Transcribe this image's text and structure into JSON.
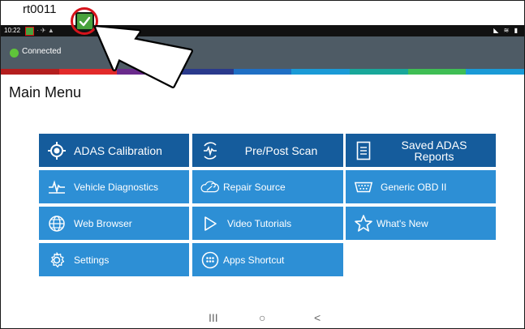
{
  "device": {
    "id": "rt0011"
  },
  "status_bar": {
    "time": "10:22"
  },
  "connection": {
    "status": "Connected",
    "color": "#5fc43a"
  },
  "page": {
    "title": "Main Menu"
  },
  "menu": {
    "adas_calibration": "ADAS Calibration",
    "pre_post_scan": "Pre/Post Scan",
    "saved_adas_reports": "Saved ADAS Reports",
    "vehicle_diagnostics": "Vehicle Diagnostics",
    "repair_source": "Repair Source",
    "generic_obd": "Generic OBD II",
    "web_browser": "Web Browser",
    "video_tutorials": "Video Tutorials",
    "whats_new": "What's New",
    "settings": "Settings",
    "apps_shortcut": "Apps Shortcut"
  },
  "nav": {
    "recents": "III",
    "home": "○",
    "back": "<"
  },
  "colors": {
    "tile_primary": "#2d8fd5",
    "tile_featured": "#155c9c",
    "header_bar": "#4e5b65",
    "annotation_red": "#d6131b",
    "rainbow": [
      "#b41e1e",
      "#e22a2a",
      "#6a2a8c",
      "#2a3a8c",
      "#1f6fc4",
      "#1a9ad6",
      "#19a79a",
      "#3fbe54",
      "#1a9ad6"
    ]
  },
  "icons": {
    "adas": "crosshair-icon",
    "scan": "pulse-icon",
    "reports": "document-icon",
    "diagnostics": "waveform-icon",
    "repair": "wrench-cloud-icon",
    "obd": "connector-icon",
    "web": "globe-icon",
    "video": "play-icon",
    "whatsnew": "star-icon",
    "settings": "gear-icon",
    "apps": "apps-grid-icon"
  }
}
